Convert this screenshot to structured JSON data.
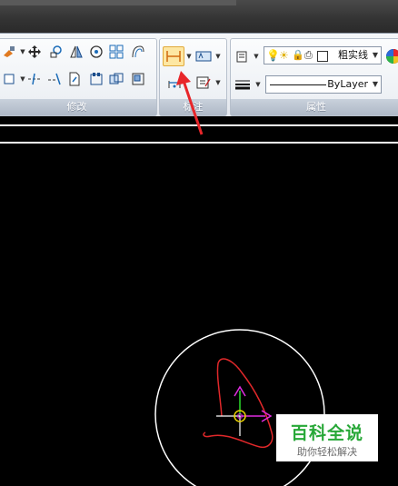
{
  "ribbon": {
    "panels": {
      "modify": {
        "title": "修改"
      },
      "annotate": {
        "title": "标注"
      },
      "properties": {
        "title": "属性",
        "layer_state": "粗实线",
        "linetype": "ByLayer"
      }
    }
  },
  "watermark": {
    "title": "百科全说",
    "subtitle": "助你轻松解决"
  },
  "colors": {
    "canvas_bg": "#000000",
    "arrow": "#e8262a",
    "circle": "#ffffff",
    "sketch": "#e0282a",
    "axis_y": "#2bdc2b",
    "axis_x": "#e02ce0",
    "watermark_green": "#28a838"
  }
}
